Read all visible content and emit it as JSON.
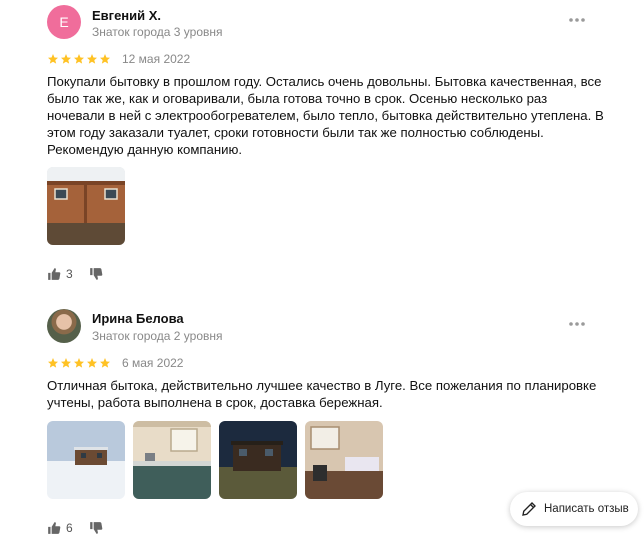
{
  "reviews": [
    {
      "avatar_letter": "Е",
      "author": "Евгений Х.",
      "level": "Знаток города 3 уровня",
      "rating": 5,
      "date": "12 мая 2022",
      "text": "Покупали бытовку в прошлом году. Остались очень довольны. Бытовка качественная, все было так же, как и оговаривали, была готова точно в срок. Осенью несколько раз ночевали в ней с электрообогревателем, было тепло, бытовка действительно утеплена. В этом году заказали туалет, сроки готовности были так же полностью соблюдены. Рекомендую данную компанию.",
      "likes": "3",
      "photos": [
        "wooden-cabin-photo"
      ]
    },
    {
      "author": "Ирина Белова",
      "level": "Знаток города 2 уровня",
      "rating": 5,
      "date": "6 мая 2022",
      "text": "Отличная бытока, действительно лучшее качество в Луге. Все пожелания по планировке учтены, работа выполнена в срок, доставка бережная.",
      "likes": "6",
      "photos": [
        "cabin-in-snow-photo",
        "cabin-interior-kitchen-photo",
        "cabin-at-dusk-photo",
        "cabin-interior-bedroom-photo"
      ]
    }
  ],
  "write_review_button": "Написать отзыв",
  "colors": {
    "star": "#ffc224",
    "avatar_letter_bg": "#f06d9b",
    "muted_text": "#888888"
  },
  "icons": [
    "more-icon",
    "star-icon",
    "thumb-up-icon",
    "thumb-down-icon",
    "pencil-icon"
  ]
}
